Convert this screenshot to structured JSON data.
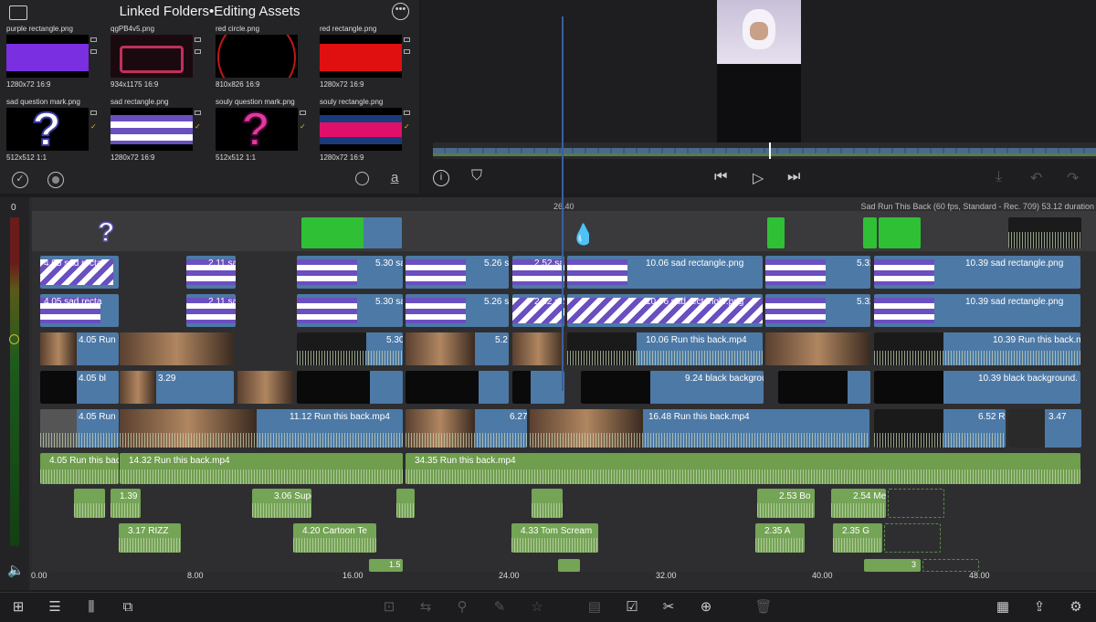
{
  "browser": {
    "title": "Linked Folders",
    "subtitle": "Editing Assets",
    "assets": [
      {
        "name": "purple rectangle.png",
        "meta": "1280x72 16:9",
        "color": "#7a2fe0"
      },
      {
        "name": "qgPB4v5.png",
        "meta": "934x1175 16:9",
        "color": "#c0305a"
      },
      {
        "name": "red circle.png",
        "meta": "810x826 16:9",
        "color": "#000000"
      },
      {
        "name": "red rectangle.png",
        "meta": "1280x72 16:9",
        "color": "#e01010"
      },
      {
        "name": "sad question mark.png",
        "meta": "512x512 1:1",
        "color": "#5a55b0"
      },
      {
        "name": "sad rectangle.png",
        "meta": "1280x72 16:9",
        "color": "#6a4fc0"
      },
      {
        "name": "souly question mark.png",
        "meta": "512x512 1:1",
        "color": "#e03a9a"
      },
      {
        "name": "souly rectangle.png",
        "meta": "1280x72 16:9",
        "color": "#e0106a"
      }
    ]
  },
  "timeline": {
    "info": "Sad Run This Back (60 fps, Standard - Rec. 709) 53.12 duration",
    "playhead": "26.40",
    "meter_zero": "0",
    "ruler": [
      "0.00",
      "8.00",
      "16.00",
      "24.00",
      "32.00",
      "40.00",
      "48.00"
    ],
    "clips": {
      "r1a": "4.05 sad recta",
      "r1b": "5.30 sa",
      "r1c": "5.26 sa",
      "r1d": "2.52 sa",
      "r1e": "10.06 sad rectangle.png",
      "r1f": "5.32",
      "r1g": "10.39 sad rectangle.png",
      "r1h": "2.11 sa",
      "r2a": "4.05 sad recta",
      "r2b": "5.30 sa",
      "r2c": "5.26 sa",
      "r2d": "2.52 sa",
      "r2e": "10.06 sad rectangle.png",
      "r2f": "5.32",
      "r2g": "10.39 sad rectangle.png",
      "r2h": "2.11 sa",
      "r3a": "4.05 Run th",
      "r3b": "5.30",
      "r3c": "5.2",
      "r3e": "10.06 Run this back.mp4",
      "r3g": "10.39 Run this back.mp4",
      "r4a": "4.05 bl",
      "r4b": "3.29",
      "r4e": "9.24 black backgrou",
      "r4g": "10.39 black background.",
      "r5a": "4.05 Run",
      "r5b": "11.12 Run this back.mp4",
      "r5c": "6.27",
      "r5e": "16.48 Run this back.mp4",
      "r5f": "6.52 Ru",
      "r5g": "3.47",
      "a1": "4.05 Run this back",
      "a2": "14.32 Run this back.mp4",
      "a3": "34.35 Run this back.mp4",
      "s1": "1.39",
      "s2": "3.06 Supe",
      "s3": "2.53 Bo",
      "s4": "2.54 Me",
      "s5": "3.17 RIZZ",
      "s6": "4.20 Cartoon Te",
      "s7": "4.33 Tom Scream",
      "s8": "2.35 A",
      "s9": "2.35 G",
      "s10": "1.5",
      "s11": "3"
    }
  },
  "colors": {
    "accent": "#4d79a6",
    "audio": "#74a455",
    "playhead": "#3a5fa0"
  }
}
